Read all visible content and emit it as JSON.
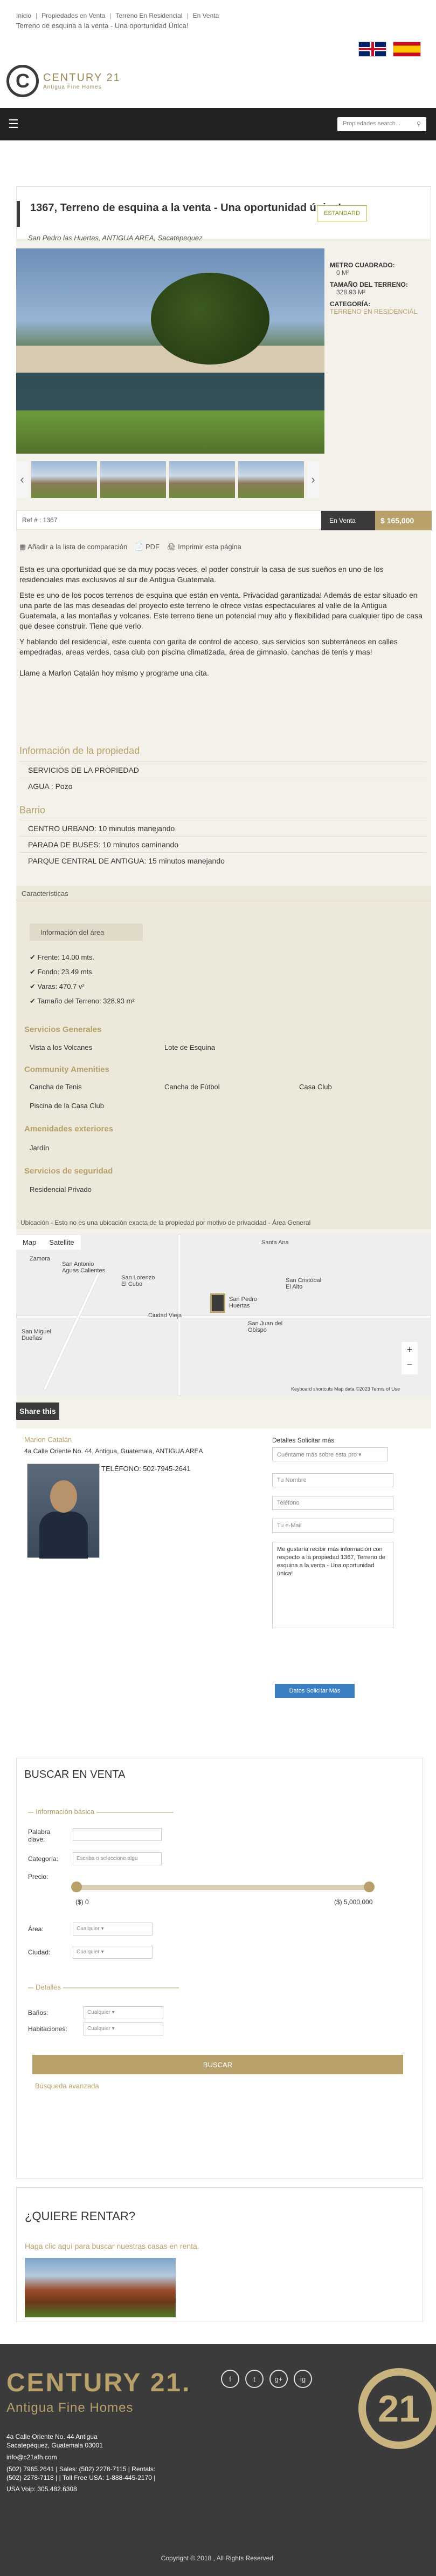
{
  "breadcrumb": {
    "home": "Inicio",
    "sale": "Propiedades en Venta",
    "type": "Terreno En Residencial",
    "op": "En Venta"
  },
  "tagline": "Terreno de esquina a la venta - Una oportunidad Única!",
  "logo": {
    "mark": "C",
    "name": "CENTURY 21",
    "sub": "Antigua Fine Homes"
  },
  "nav": {
    "search_placeholder": "Propiedades search..."
  },
  "listing": {
    "title": "1367, Terreno de esquina a la venta - Una oportunidad única!",
    "badge": "ESTANDARD",
    "address": "San Pedro las Huertas, ANTIGUA AREA, Sacatepequez",
    "specs": {
      "m2_label": "METRO CUADRADO:",
      "m2_value": "0 M²",
      "size_label": "TAMAÑO DEL TERRENO:",
      "size_value": "328.93 M²",
      "cat_label": "CATEGORÍA:",
      "cat_value": "TERRENO EN RESIDENCIAL"
    },
    "ref": "Ref # : 1367",
    "operation": "En Venta",
    "price": "$ 165,000",
    "tools": {
      "compare": "Añadir a la lista de comparación",
      "pdf": "PDF",
      "print": "Imprimir esta página"
    },
    "desc": [
      "Esta es una oportunidad que se da muy pocas veces, el poder construir la casa de sus sueños en uno de los residenciales mas exclusivos al sur de Antigua Guatemala.",
      "Este es uno de los pocos terrenos de esquina que están en venta. Privacidad garantizada! Además de estar situado en una parte de las mas deseadas del proyecto este terreno le ofrece vistas espectaculares al valle de la Antigua Guatemala, a las montañas y volcanes. Este terreno tiene un potencial muy alto y flexibilidad para cualquier tipo de casa que desee construir. Tiene que verlo.",
      "Y hablando del residencial, este cuenta con garita de control de acceso, sus servicios son subterráneos en calles empedradas, areas verdes, casa club con piscina climatizada, área de gimnasio, canchas de tenis y mas!",
      "Llame a Marlon Catalán hoy mismo y programe una cita."
    ],
    "prop_heading": "Información de la propiedad",
    "services_heading": "SERVICIOS DE LA PROPIEDAD",
    "water": "AGUA :   Pozo",
    "barrio_heading": "Barrio",
    "barrio": [
      "CENTRO URBANO:   10 minutos manejando",
      "PARADA DE BUSES:   10 minutos caminando",
      "PARQUE CENTRAL DE ANTIGUA:   15 minutos manejando"
    ]
  },
  "features": {
    "header": "Características",
    "info_tab": "Información del área",
    "checks": [
      "Frente: 14.00 mts.",
      "Fondo: 23.49 mts.",
      "Varas: 470.7 v²",
      "Tamaño del Terreno: 328.93 m²"
    ],
    "general_h": "Servicios Generales",
    "general": [
      "Vista a los Volcanes",
      "Lote de Esquina"
    ],
    "community_h": "Community Amenities",
    "community": [
      "Cancha de Tenis",
      "Cancha de Fútbol",
      "Casa Club",
      "Piscina de la Casa Club"
    ],
    "outdoor_h": "Amenidades exteriores",
    "outdoor": [
      "Jardín"
    ],
    "security_h": "Servicios de seguridad",
    "security": [
      "Residencial Privado"
    ]
  },
  "map": {
    "note": "Ubicación - Esto no es una ubicación exacta de la propiedad por motivo de privacidad - Área General",
    "tab_map": "Map",
    "tab_sat": "Satellite",
    "towns": [
      "Santa Ana",
      "Zamora",
      "San Antonio Aguas Calientes",
      "San Lorenzo El Cubo",
      "San Pedro Huertas",
      "San Cristóbal El Alto",
      "Ciudad Vieja",
      "San Miguel Dueñas",
      "San Juan del Obispo"
    ],
    "attribution": "Keyboard shortcuts   Map data ©2023   Terms of Use"
  },
  "share": "Share this",
  "agent": {
    "name": "Marlon Catalán",
    "address": "4a Calle Oriente No. 44, Antigua, Guatemala, ANTIGUA AREA",
    "tel": "TELÉFONO:   502-7945-2641"
  },
  "contact": {
    "heading": "Detalles Solicitar más",
    "select": "Cuéntame más sobre esta pro",
    "name": "Tu Nombre",
    "phone": "Teléfono",
    "email": "Tu e-Mail",
    "message": "Me gustaría recibir más información con respecto a la propiedad 1367, Terreno de esquina a la venta - Una oportunidad única!",
    "send": "Datos Solicitar Más"
  },
  "search": {
    "title": "BUSCAR EN VENTA",
    "basic": "Información básica",
    "keyword": "Palabra clave:",
    "category": "Categoría:",
    "category_ph": "Escriba o seleccione algu",
    "price": "Precio:",
    "min": "($) 0",
    "max": "($) 5,000,000",
    "area": "Área:",
    "area_val": "Cualquier",
    "city": "Ciudad:",
    "city_val": "Cualquier",
    "details": "Detalles",
    "baths": "Baños:",
    "baths_val": "Cualquier",
    "rooms": "Habitaciones:",
    "rooms_val": "Cualquier",
    "button": "BUSCAR",
    "advanced": "Búsqueda avanzada"
  },
  "rent": {
    "title": "¿QUIERE RENTAR?",
    "link": "Haga clic aquí para buscar nuestras casas en renta."
  },
  "footer": {
    "brand": "CENTURY 21.",
    "brand2": "Antigua Fine Homes",
    "bigc": "21",
    "social": [
      "f",
      "t",
      "g+",
      "ig"
    ],
    "lines": [
      "4a Calle Oriente No. 44 Antigua",
      "Sacatepéquez, Guatemala 03001",
      "info@c21afh.com",
      "(502) 7965.2641 | Sales: (502) 2278-7115 | Rentals:",
      "(502) 2278-7118 | | Toll Free USA: 1-888-445-2170 |",
      "USA Voip: 305.482.6308"
    ],
    "copyright": "Copyright © 2018 , All Rights Reserved."
  }
}
